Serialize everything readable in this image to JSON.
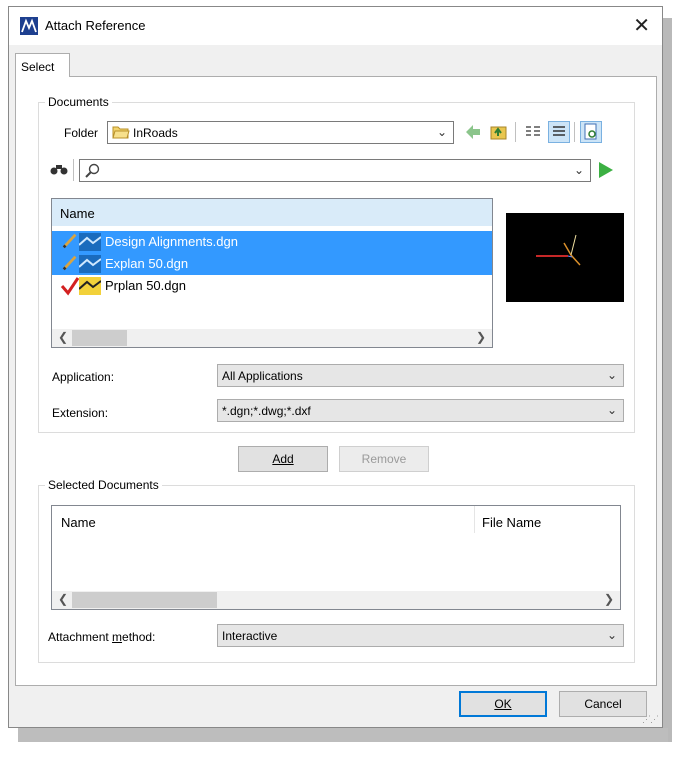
{
  "window": {
    "title": "Attach Reference",
    "close_glyph": "✕"
  },
  "tabs": [
    {
      "label": "Select"
    }
  ],
  "documents": {
    "legend": "Documents",
    "folder_label": "Folder",
    "folder_value": "InRoads",
    "search_value": "",
    "list_header": "Name",
    "files": [
      {
        "name": "Design Alignments.dgn",
        "selected": true,
        "status_icon": "pencil-icon"
      },
      {
        "name": "Explan 50.dgn",
        "selected": true,
        "status_icon": "pencil-icon"
      },
      {
        "name": "Prplan 50.dgn",
        "selected": false,
        "status_icon": "checkmark-icon"
      }
    ],
    "application_label": "Application:",
    "application_value": "All Applications",
    "extension_label": "Extension:",
    "extension_value": "*.dgn;*.dwg;*.dxf"
  },
  "buttons": {
    "add": "Add",
    "remove": "Remove",
    "ok": "OK",
    "cancel": "Cancel"
  },
  "selected_documents": {
    "legend": "Selected Documents",
    "col_name": "Name",
    "col_filename": "File Name",
    "attachment_label_pre": "Attachment ",
    "attachment_label_key": "m",
    "attachment_label_post": "ethod:",
    "attachment_value": "Interactive"
  },
  "colors": {
    "selection": "#3399ff",
    "accent": "#0078d7"
  }
}
